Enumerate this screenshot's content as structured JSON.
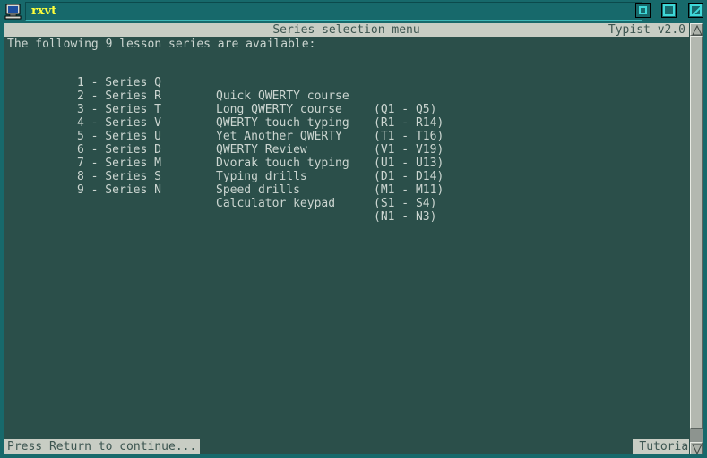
{
  "window": {
    "title": "rxvt",
    "icon": "computer-icon",
    "buttons": {
      "minimize": "minimize",
      "maximize": "maximize",
      "close": "close"
    }
  },
  "header": {
    "center_title": "Series selection menu",
    "right_title": "Typist v2.0"
  },
  "content": {
    "intro": "The following 9 lesson series are available:",
    "items": [
      {
        "key": "1 - Series Q",
        "description": "Quick QWERTY course",
        "range": "(Q1 - Q5)"
      },
      {
        "key": "2 - Series R",
        "description": "Long QWERTY course",
        "range": "(R1 - R14)"
      },
      {
        "key": "3 - Series T",
        "description": "QWERTY touch typing",
        "range": "(T1 - T16)"
      },
      {
        "key": "4 - Series V",
        "description": "Yet Another QWERTY",
        "range": "(V1 - V19)"
      },
      {
        "key": "5 - Series U",
        "description": "QWERTY Review",
        "range": "(U1 - U13)"
      },
      {
        "key": "6 - Series D",
        "description": "Dvorak touch typing",
        "range": "(D1 - D14)"
      },
      {
        "key": "7 - Series M",
        "description": "Typing drills",
        "range": "(M1 - M11)"
      },
      {
        "key": "8 - Series S",
        "description": "Speed drills",
        "range": "(S1 - S4)"
      },
      {
        "key": "9 - Series N",
        "description": "Calculator keypad",
        "range": "(N1 - N3)"
      }
    ]
  },
  "footer": {
    "status": "Press Return to continue...",
    "tutorial_label": "Tutorial"
  },
  "scrollbar": {
    "up_arrow": "scroll-up-arrow-icon",
    "down_arrow": "scroll-down-arrow-icon"
  },
  "colors": {
    "terminal_bg": "#2b4f4a",
    "terminal_fg": "#ccd6d1",
    "frame": "#17696b",
    "panel_bg": "#c8cdc4",
    "panel_fg": "#3c5550",
    "title_fg": "#ffff3b",
    "btn_accent": "#3fd8d8"
  }
}
